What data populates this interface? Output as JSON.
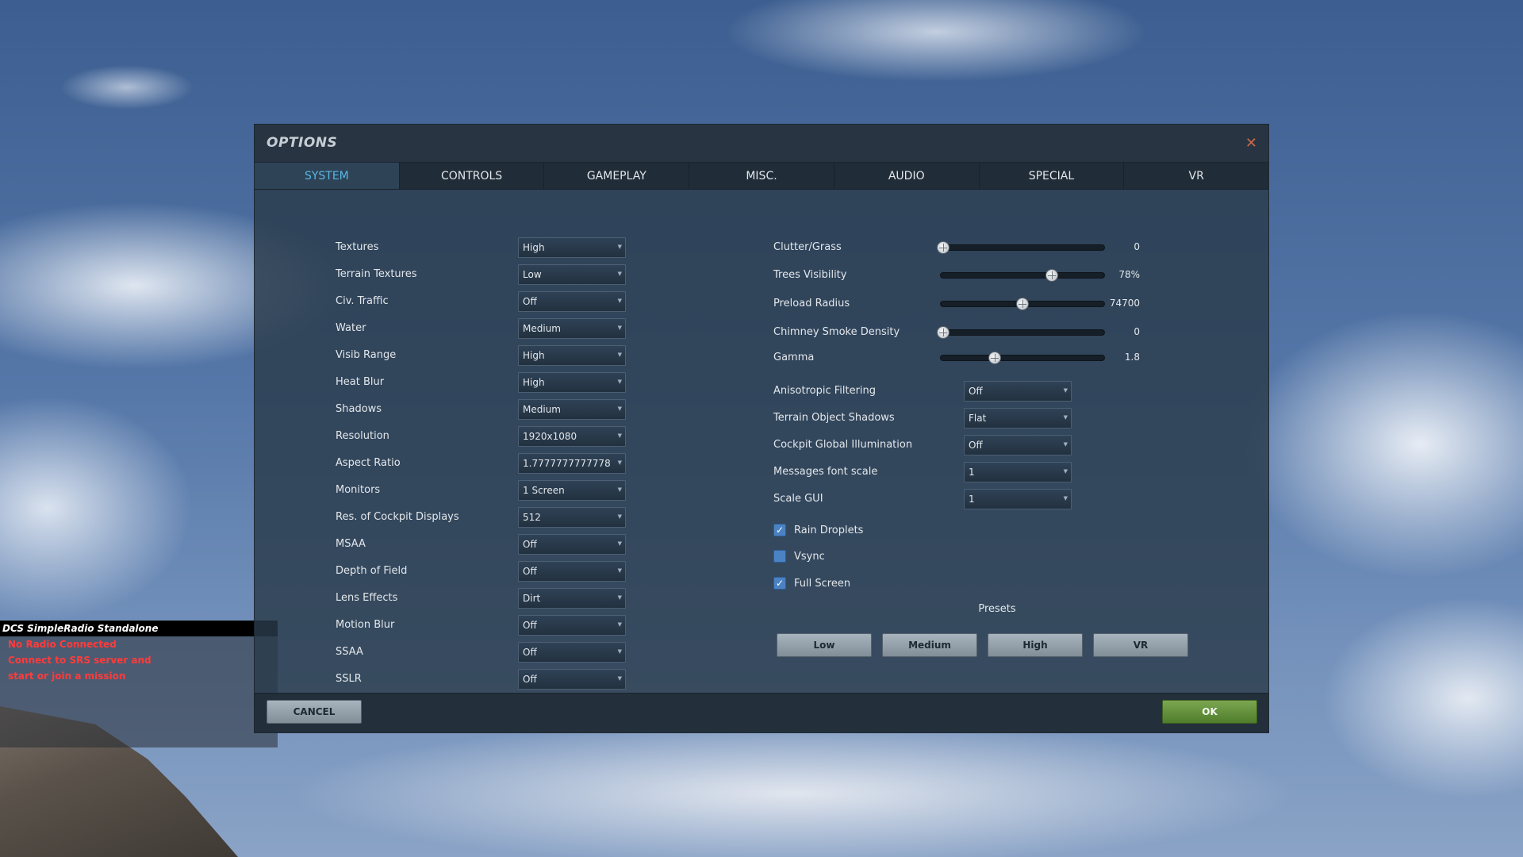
{
  "dialog": {
    "title": "OPTIONS",
    "close_icon": "close-icon"
  },
  "tabs": [
    {
      "label": "SYSTEM",
      "active": true
    },
    {
      "label": "CONTROLS"
    },
    {
      "label": "GAMEPLAY"
    },
    {
      "label": "MISC."
    },
    {
      "label": "AUDIO"
    },
    {
      "label": "SPECIAL"
    },
    {
      "label": "VR"
    }
  ],
  "left_settings": [
    {
      "label": "Textures",
      "value": "High"
    },
    {
      "label": "Terrain Textures",
      "value": "Low"
    },
    {
      "label": "Civ. Traffic",
      "value": "Off"
    },
    {
      "label": "Water",
      "value": "Medium"
    },
    {
      "label": "Visib Range",
      "value": "High"
    },
    {
      "label": "Heat Blur",
      "value": "High"
    },
    {
      "label": "Shadows",
      "value": "Medium"
    },
    {
      "label": "Resolution",
      "value": "1920x1080"
    },
    {
      "label": "Aspect Ratio",
      "value": "1.7777777777778"
    },
    {
      "label": "Monitors",
      "value": "1 Screen"
    },
    {
      "label": "Res. of Cockpit Displays",
      "value": "512"
    },
    {
      "label": "MSAA",
      "value": "Off"
    },
    {
      "label": "Depth of Field",
      "value": "Off"
    },
    {
      "label": "Lens Effects",
      "value": "Dirt"
    },
    {
      "label": "Motion Blur",
      "value": "Off"
    },
    {
      "label": "SSAA",
      "value": "Off"
    },
    {
      "label": "SSLR",
      "value": "Off"
    }
  ],
  "sliders": [
    {
      "label": "Clutter/Grass",
      "value": "0",
      "fraction": 0.02
    },
    {
      "label": "Trees Visibility",
      "value": "78%",
      "fraction": 0.68
    },
    {
      "label": "Preload Radius",
      "value": "74700",
      "fraction": 0.5
    },
    {
      "label": "Chimney Smoke Density",
      "value": "0",
      "fraction": 0.02
    },
    {
      "label": "Gamma",
      "value": "1.8",
      "fraction": 0.33
    }
  ],
  "right_dropdowns": [
    {
      "label": "Anisotropic Filtering",
      "value": "Off"
    },
    {
      "label": "Terrain Object Shadows",
      "value": "Flat"
    },
    {
      "label": "Cockpit Global Illumination",
      "value": "Off"
    },
    {
      "label": "Messages font scale",
      "value": "1"
    },
    {
      "label": "Scale GUI",
      "value": "1"
    }
  ],
  "checkboxes": [
    {
      "label": "Rain Droplets",
      "checked": true,
      "mark": "✓"
    },
    {
      "label": "Vsync",
      "checked": false,
      "mark": ""
    },
    {
      "label": "Full Screen",
      "checked": true,
      "mark": "✓"
    }
  ],
  "presets": {
    "label": "Presets",
    "buttons": [
      "Low",
      "Medium",
      "High",
      "VR"
    ]
  },
  "footer": {
    "cancel": "CANCEL",
    "ok": "OK"
  },
  "srs": {
    "title": "DCS SimpleRadio Standalone",
    "lines": [
      "No Radio Connected",
      "Connect to SRS server and",
      "start or join a mission"
    ]
  },
  "colors": {
    "active_tab": "#57b7e4",
    "ok_green": "#5f8f37",
    "srs_red": "#ff3b3b",
    "close_accent": "#c86a4a"
  }
}
